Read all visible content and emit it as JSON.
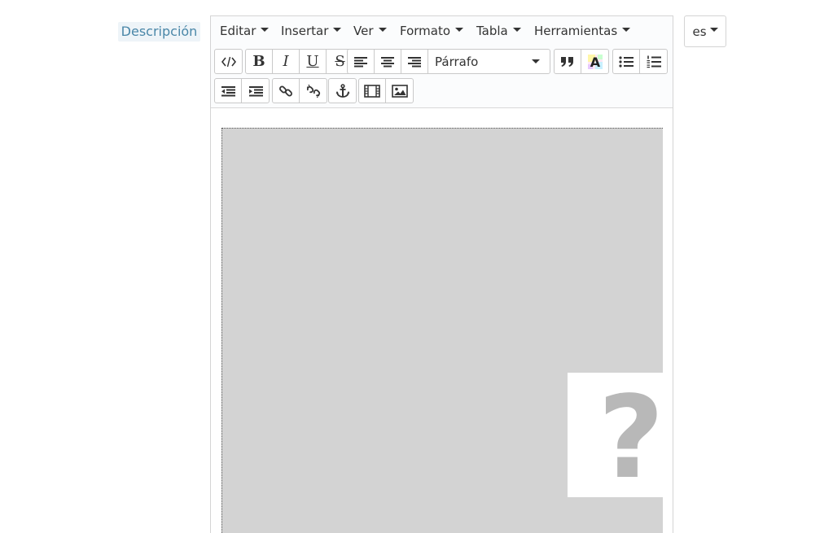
{
  "field": {
    "label": "Descripción"
  },
  "menu": {
    "items": [
      {
        "label": "Editar"
      },
      {
        "label": "Insertar"
      },
      {
        "label": "Ver"
      },
      {
        "label": "Formato"
      },
      {
        "label": "Tabla"
      },
      {
        "label": "Herramientas"
      }
    ]
  },
  "toolbar": {
    "format_select": "Párrafo",
    "buttons": {
      "source_code": "code-icon",
      "bold": "B",
      "italic": "I",
      "underline": "U",
      "strikethrough": "S",
      "align_left": "align-left-icon",
      "align_center": "align-center-icon",
      "align_right": "align-right-icon",
      "blockquote": "quote-icon",
      "text_color": "A",
      "bullet_list": "bullet-list-icon",
      "numbered_list": "numbered-list-icon",
      "outdent": "outdent-icon",
      "indent": "indent-icon",
      "link": "link-icon",
      "unlink": "unlink-icon",
      "anchor": "anchor-icon",
      "media": "film-icon",
      "image": "image-icon"
    }
  },
  "content": {
    "broken_image_symbol": "?"
  },
  "language": {
    "selected": "es"
  },
  "colors": {
    "label_text": "#4a87a8",
    "label_bg": "#eef4f8",
    "edit_bg": "#d3d3d3",
    "question_mark": "#b8b8b8"
  }
}
